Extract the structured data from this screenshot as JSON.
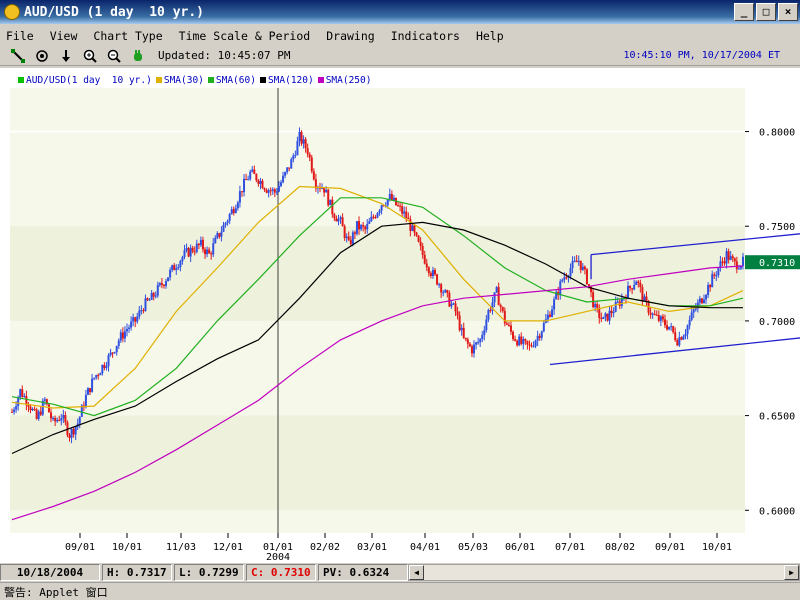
{
  "window": {
    "title": "AUD/USD (1 day  10 yr.)",
    "controls": [
      "_",
      "□",
      "×"
    ]
  },
  "menu": [
    "File",
    "View",
    "Chart Type",
    "Time Scale & Period",
    "Drawing",
    "Indicators",
    "Help"
  ],
  "toolbar": {
    "icons": [
      "line-draw-icon",
      "target-icon",
      "down-arrow-icon",
      "zoom-in-icon",
      "zoom-out-icon",
      "hand-icon"
    ],
    "updated_text": "Updated: 10:45:07 PM",
    "clock_text": "10:45:10 PM, 10/17/2004 ET"
  },
  "legend": [
    {
      "label": "AUD/USD(1 day  10 yr.)",
      "color": "#00c000"
    },
    {
      "label": "SMA(30)",
      "color": "#e0b000"
    },
    {
      "label": "SMA(60)",
      "color": "#20b020"
    },
    {
      "label": "SMA(120)",
      "color": "#000000"
    },
    {
      "label": "SMA(250)",
      "color": "#c000c0"
    }
  ],
  "chart_data": {
    "type": "candlestick",
    "y_ticks": [
      "0.8000",
      "0.7500",
      "0.7000",
      "0.6500",
      "0.6000"
    ],
    "y_tick_values": [
      0.8,
      0.75,
      0.7,
      0.65,
      0.6
    ],
    "ylim": [
      0.588,
      0.823
    ],
    "x_ticks": [
      "09/01",
      "10/01",
      "11/03",
      "12/01",
      "01/01",
      "02/02",
      "03/01",
      "04/01",
      "05/03",
      "06/01",
      "07/01",
      "08/02",
      "09/01",
      "10/01"
    ],
    "year_label": "2004",
    "current_value_label": "0.7310",
    "current_value": 0.731,
    "price_path": [
      [
        0,
        0.652
      ],
      [
        4,
        0.663
      ],
      [
        8,
        0.657
      ],
      [
        12,
        0.648
      ],
      [
        16,
        0.658
      ],
      [
        20,
        0.646
      ],
      [
        24,
        0.65
      ],
      [
        28,
        0.64
      ],
      [
        32,
        0.646
      ],
      [
        36,
        0.66
      ],
      [
        40,
        0.67
      ],
      [
        44,
        0.676
      ],
      [
        48,
        0.682
      ],
      [
        52,
        0.69
      ],
      [
        56,
        0.696
      ],
      [
        60,
        0.7
      ],
      [
        64,
        0.708
      ],
      [
        68,
        0.712
      ],
      [
        72,
        0.718
      ],
      [
        76,
        0.724
      ],
      [
        80,
        0.73
      ],
      [
        84,
        0.735
      ],
      [
        88,
        0.738
      ],
      [
        92,
        0.74
      ],
      [
        96,
        0.735
      ],
      [
        100,
        0.744
      ],
      [
        104,
        0.752
      ],
      [
        108,
        0.76
      ],
      [
        112,
        0.77
      ],
      [
        116,
        0.778
      ],
      [
        120,
        0.775
      ],
      [
        124,
        0.77
      ],
      [
        128,
        0.768
      ],
      [
        132,
        0.775
      ],
      [
        136,
        0.784
      ],
      [
        140,
        0.797
      ],
      [
        144,
        0.79
      ],
      [
        148,
        0.773
      ],
      [
        152,
        0.77
      ],
      [
        156,
        0.758
      ],
      [
        160,
        0.752
      ],
      [
        164,
        0.74
      ],
      [
        168,
        0.75
      ],
      [
        172,
        0.748
      ],
      [
        176,
        0.755
      ],
      [
        180,
        0.762
      ],
      [
        184,
        0.765
      ],
      [
        188,
        0.76
      ],
      [
        192,
        0.755
      ],
      [
        196,
        0.745
      ],
      [
        200,
        0.735
      ],
      [
        204,
        0.726
      ],
      [
        208,
        0.72
      ],
      [
        212,
        0.712
      ],
      [
        216,
        0.705
      ],
      [
        220,
        0.69
      ],
      [
        224,
        0.685
      ],
      [
        228,
        0.69
      ],
      [
        232,
        0.705
      ],
      [
        236,
        0.715
      ],
      [
        240,
        0.7
      ],
      [
        244,
        0.692
      ],
      [
        248,
        0.688
      ],
      [
        252,
        0.686
      ],
      [
        256,
        0.692
      ],
      [
        260,
        0.7
      ],
      [
        264,
        0.71
      ],
      [
        268,
        0.722
      ],
      [
        272,
        0.728
      ],
      [
        276,
        0.732
      ],
      [
        280,
        0.722
      ],
      [
        284,
        0.706
      ],
      [
        288,
        0.7
      ],
      [
        292,
        0.705
      ],
      [
        296,
        0.71
      ],
      [
        300,
        0.716
      ],
      [
        304,
        0.722
      ],
      [
        308,
        0.71
      ],
      [
        312,
        0.703
      ],
      [
        316,
        0.7
      ],
      [
        320,
        0.697
      ],
      [
        324,
        0.69
      ],
      [
        328,
        0.695
      ],
      [
        332,
        0.705
      ],
      [
        336,
        0.712
      ],
      [
        340,
        0.72
      ],
      [
        344,
        0.728
      ],
      [
        348,
        0.735
      ],
      [
        352,
        0.73
      ],
      [
        356,
        0.731
      ]
    ],
    "series": [
      {
        "name": "SMA(30)",
        "color": "#e0b000",
        "points": [
          [
            0,
            0.657
          ],
          [
            20,
            0.654
          ],
          [
            40,
            0.655
          ],
          [
            60,
            0.675
          ],
          [
            80,
            0.705
          ],
          [
            100,
            0.728
          ],
          [
            120,
            0.752
          ],
          [
            140,
            0.771
          ],
          [
            160,
            0.77
          ],
          [
            180,
            0.762
          ],
          [
            200,
            0.748
          ],
          [
            220,
            0.722
          ],
          [
            240,
            0.7
          ],
          [
            260,
            0.7
          ],
          [
            280,
            0.705
          ],
          [
            300,
            0.71
          ],
          [
            320,
            0.705
          ],
          [
            340,
            0.708
          ],
          [
            356,
            0.716
          ]
        ]
      },
      {
        "name": "SMA(60)",
        "color": "#20b020",
        "points": [
          [
            0,
            0.66
          ],
          [
            20,
            0.656
          ],
          [
            40,
            0.65
          ],
          [
            60,
            0.658
          ],
          [
            80,
            0.675
          ],
          [
            100,
            0.7
          ],
          [
            120,
            0.722
          ],
          [
            140,
            0.745
          ],
          [
            160,
            0.765
          ],
          [
            180,
            0.765
          ],
          [
            200,
            0.76
          ],
          [
            220,
            0.745
          ],
          [
            240,
            0.728
          ],
          [
            260,
            0.716
          ],
          [
            280,
            0.71
          ],
          [
            300,
            0.712
          ],
          [
            320,
            0.708
          ],
          [
            340,
            0.708
          ],
          [
            356,
            0.712
          ]
        ]
      },
      {
        "name": "SMA(120)",
        "color": "#000000",
        "points": [
          [
            0,
            0.63
          ],
          [
            20,
            0.64
          ],
          [
            40,
            0.648
          ],
          [
            60,
            0.655
          ],
          [
            80,
            0.668
          ],
          [
            100,
            0.68
          ],
          [
            120,
            0.69
          ],
          [
            140,
            0.712
          ],
          [
            160,
            0.736
          ],
          [
            180,
            0.75
          ],
          [
            200,
            0.752
          ],
          [
            220,
            0.748
          ],
          [
            240,
            0.74
          ],
          [
            260,
            0.73
          ],
          [
            280,
            0.718
          ],
          [
            300,
            0.712
          ],
          [
            320,
            0.708
          ],
          [
            340,
            0.707
          ],
          [
            356,
            0.707
          ]
        ]
      },
      {
        "name": "SMA(250)",
        "color": "#c000c0",
        "points": [
          [
            0,
            0.595
          ],
          [
            20,
            0.602
          ],
          [
            40,
            0.61
          ],
          [
            60,
            0.62
          ],
          [
            80,
            0.632
          ],
          [
            100,
            0.645
          ],
          [
            120,
            0.658
          ],
          [
            140,
            0.675
          ],
          [
            160,
            0.69
          ],
          [
            180,
            0.7
          ],
          [
            200,
            0.708
          ],
          [
            220,
            0.712
          ],
          [
            240,
            0.714
          ],
          [
            260,
            0.716
          ],
          [
            280,
            0.718
          ],
          [
            300,
            0.722
          ],
          [
            320,
            0.725
          ],
          [
            340,
            0.728
          ],
          [
            356,
            0.729
          ]
        ]
      }
    ],
    "channel_upper": [
      [
        282,
        0.735
      ],
      [
        400,
        0.746
      ]
    ],
    "channel_lower": [
      [
        262,
        0.677
      ],
      [
        400,
        0.691
      ]
    ]
  },
  "status": {
    "date": "10/18/2004",
    "high": "H: 0.7317",
    "low": "L: 0.7299",
    "close": "C: 0.7310",
    "pv": "PV: 0.6324"
  },
  "warning_text": "警告: Applet 窗口"
}
